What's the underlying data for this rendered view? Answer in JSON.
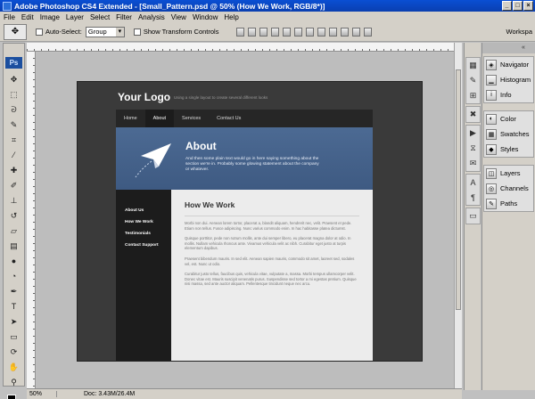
{
  "window": {
    "title": "Adobe Photoshop CS4 Extended - [Small_Pattern.psd @ 50% (How We Work, RGB/8*)]",
    "controls": [
      "_",
      "□",
      "×"
    ]
  },
  "menubar": [
    "File",
    "Edit",
    "Image",
    "Layer",
    "Select",
    "Filter",
    "Analysis",
    "View",
    "Window",
    "Help"
  ],
  "options": {
    "auto_select_label": "Auto-Select:",
    "auto_select_value": "Group",
    "transform_label": "Show Transform Controls",
    "workspace_label": "Workspa"
  },
  "toolbox": {
    "logo": "Ps",
    "tools": [
      "move-tool",
      "marquee-tool",
      "lasso-tool",
      "quick-select-tool",
      "crop-tool",
      "eyedropper-tool",
      "healing-tool",
      "brush-tool",
      "clone-stamp-tool",
      "history-brush-tool",
      "eraser-tool",
      "gradient-tool",
      "blur-tool",
      "dodge-tool",
      "pen-tool",
      "type-tool",
      "path-select-tool",
      "shape-tool",
      "3d-rotate-tool",
      "3d-orbit-tool",
      "hand-tool",
      "zoom-tool"
    ]
  },
  "document": {
    "logo": "Your Logo",
    "tagline": "Using a single layout to create several different looks",
    "nav": [
      "Home",
      "About",
      "Services",
      "Contact Us"
    ],
    "nav_active": "About",
    "hero_title": "About",
    "hero_text": "And then some plain text would go in here saying something about the section we're in.  Probably some glowing statement about the company or whatever.",
    "sidebar": [
      "About Us",
      "How We Work",
      "Testimonials",
      "Contact Support"
    ],
    "content_title": "How We Work",
    "paragraphs": [
      "Morbi non dui. Aenean lorem tortor, placerat a, blandit aliquam, hendrerit nec, velit. Praesent et pede. Etiam non tellus. Fusce adipiscing. Nunc varius commodo enim. In hac habitasse platea dictumst.",
      "Quisque porttitor, pede non rutrum mollis, ante dui semper libero, eu placerat magna dolor at odio. In mollis. Nullam vehicula rhoncus ante. Vivamus vehicula velit ac nibh. Curabitur eget justo at turpis elementum dapibus.",
      "Praesent bibendum mauris. In sed elit. Aenean sapien mauris, commodo sit amet, laoreet sed, sodales vel, est. Nunc ut odio.",
      "Curabitur justo tellus, faucibus quis, vehicula vitae, vulputate a, massa. Morbi tempus ullamcorper velit. Donec vitae est. Mauris suscipit venenatis purus. Suspendisse sed tortor a mi egestas pretium. Quisque nisi massa, sed ante auctor aliquam. Pellentesque tincidunt neque nec arcu."
    ]
  },
  "statusbar": {
    "zoom": "50%",
    "doc_size": "Doc: 3.43M/26.4M"
  },
  "panels": {
    "groups": [
      [
        {
          "label": "Navigator",
          "icon": "navigator-icon"
        },
        {
          "label": "Histogram",
          "icon": "histogram-icon"
        },
        {
          "label": "Info",
          "icon": "info-icon"
        }
      ],
      [
        {
          "label": "Color",
          "icon": "color-icon"
        },
        {
          "label": "Swatches",
          "icon": "swatches-icon"
        },
        {
          "label": "Styles",
          "icon": "styles-icon"
        }
      ],
      [
        {
          "label": "Layers",
          "icon": "layers-icon"
        },
        {
          "label": "Channels",
          "icon": "channels-icon"
        },
        {
          "label": "Paths",
          "icon": "paths-icon"
        }
      ]
    ]
  },
  "colors": {
    "titlebar": "#0a4fd3",
    "chrome": "#d4d0c8",
    "doc_bg": "#3a3a3a",
    "hero": "#4c6a93",
    "sidebar": "#1c1c1c",
    "content": "#ececec"
  }
}
